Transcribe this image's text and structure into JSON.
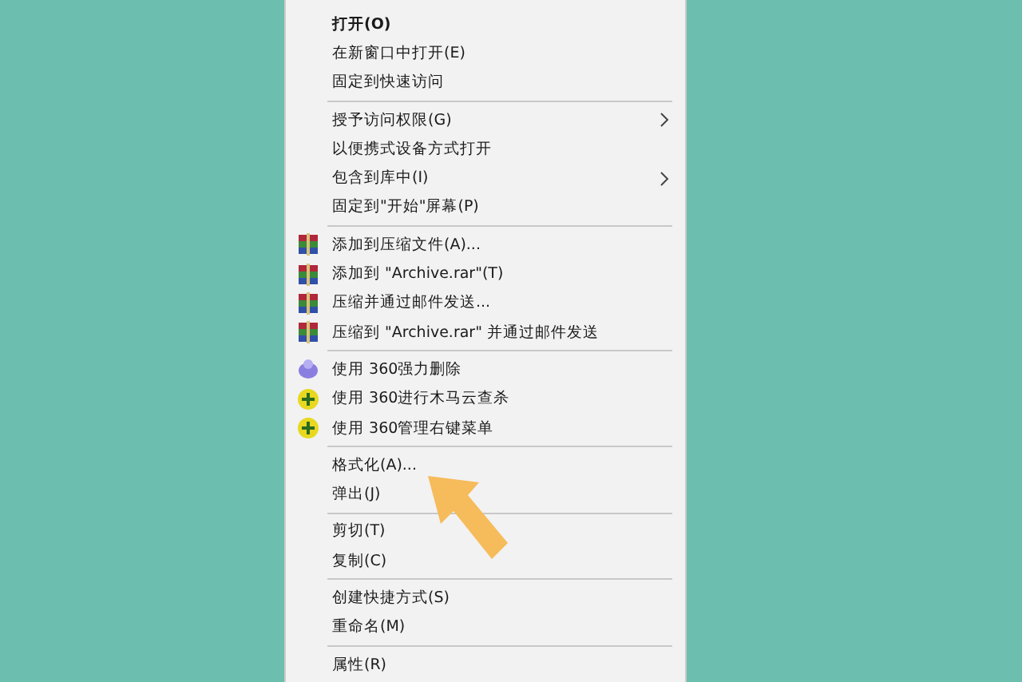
{
  "context_menu": {
    "groups": [
      {
        "items": [
          {
            "label": "打开(O)",
            "default": true
          },
          {
            "label": "在新窗口中打开(E)"
          },
          {
            "label": "固定到快速访问"
          }
        ]
      },
      {
        "items": [
          {
            "label": "授予访问权限(G)",
            "submenu": true
          },
          {
            "label": "以便携式设备方式打开"
          },
          {
            "label": "包含到库中(I)",
            "submenu": true
          },
          {
            "label": "固定到\"开始\"屏幕(P)"
          }
        ]
      },
      {
        "items": [
          {
            "label": "添加到压缩文件(A)...",
            "kind": "archive"
          },
          {
            "label": "添加到 \"Archive.rar\"(T)",
            "kind": "archive"
          },
          {
            "label": "压缩并通过邮件发送...",
            "kind": "archive"
          },
          {
            "label": "压缩到 \"Archive.rar\" 并通过邮件发送",
            "kind": "archive"
          }
        ]
      },
      {
        "items": [
          {
            "label": "使用 360强力删除",
            "kind": "bubble"
          },
          {
            "label": "使用 360进行木马云查杀",
            "kind": "badge"
          },
          {
            "label": "使用 360管理右键菜单",
            "kind": "badge"
          }
        ]
      },
      {
        "items": [
          {
            "label": "格式化(A)..."
          },
          {
            "label": "弹出(J)"
          }
        ]
      },
      {
        "items": [
          {
            "label": "剪切(T)"
          },
          {
            "label": "复制(C)"
          }
        ]
      },
      {
        "items": [
          {
            "label": "创建快捷方式(S)"
          },
          {
            "label": "重命名(M)"
          }
        ]
      },
      {
        "items": [
          {
            "label": "属性(R)"
          }
        ]
      }
    ]
  }
}
